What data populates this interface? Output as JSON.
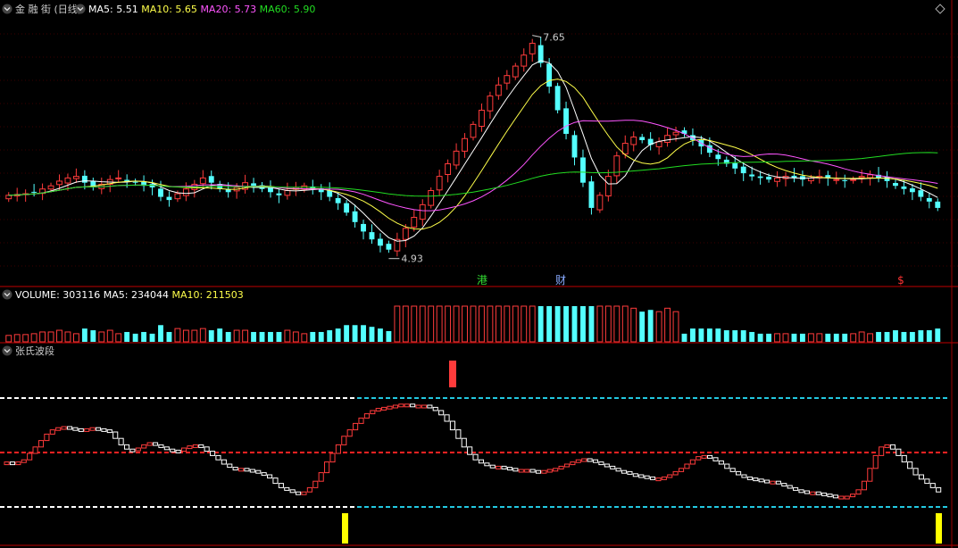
{
  "colors": {
    "up": "#ff3b3b",
    "down": "#54ffff",
    "ma5": "#ffffff",
    "ma10": "#ffff4a",
    "ma20": "#ff55ff",
    "ma60": "#22dd22",
    "sep": "#9a0000",
    "grid": "#7a0000",
    "label": "#cccccc",
    "cyan_line": "#22c8e0",
    "red_line": "#ff2222",
    "white_line": "#ffffff",
    "yellow": "#ffff00"
  },
  "price_panel": {
    "title": "金 融 街 (日线)",
    "indicators": [
      {
        "label": "MA5:",
        "value": "5.51",
        "color_key": "ma5"
      },
      {
        "label": "MA10:",
        "value": "5.65",
        "color_key": "ma10"
      },
      {
        "label": "MA20:",
        "value": "5.73",
        "color_key": "ma20"
      },
      {
        "label": "MA60:",
        "value": "5.90",
        "color_key": "ma60"
      }
    ],
    "high_label": "7.65",
    "low_label": "4.93",
    "markers": [
      {
        "text": "港",
        "color": "#33dd33"
      },
      {
        "text": "财",
        "color": "#88aaff"
      },
      {
        "text": "$",
        "color": "#ff3333"
      }
    ]
  },
  "volume_panel": {
    "indicators": [
      {
        "label": "VOLUME:",
        "value": "303116",
        "color_key": "ma5"
      },
      {
        "label": "MA5:",
        "value": "234044",
        "color_key": "ma5"
      },
      {
        "label": "MA10:",
        "value": "211503",
        "color_key": "ma10"
      }
    ]
  },
  "wave_panel": {
    "title": "张氏波段"
  },
  "chart_data": {
    "type": "candlestick",
    "title": "金 融 街 (日线)",
    "price_extremes": {
      "high": 7.65,
      "low": 4.93
    },
    "ma_latest": {
      "MA5": 5.51,
      "MA10": 5.65,
      "MA20": 5.73,
      "MA60": 5.9
    },
    "volume_latest": {
      "VOLUME": 303116,
      "MA5": 234044,
      "MA10": 211503
    },
    "close_series": [
      5.62,
      5.63,
      5.64,
      5.66,
      5.7,
      5.74,
      5.8,
      5.84,
      5.86,
      5.78,
      5.72,
      5.76,
      5.82,
      5.84,
      5.8,
      5.78,
      5.74,
      5.72,
      5.6,
      5.56,
      5.64,
      5.7,
      5.76,
      5.84,
      5.78,
      5.7,
      5.66,
      5.72,
      5.78,
      5.74,
      5.7,
      5.66,
      5.62,
      5.68,
      5.72,
      5.74,
      5.7,
      5.66,
      5.6,
      5.52,
      5.4,
      5.28,
      5.16,
      5.06,
      4.98,
      4.93,
      5.06,
      5.2,
      5.34,
      5.5,
      5.68,
      5.86,
      6.02,
      6.18,
      6.34,
      6.52,
      6.7,
      6.88,
      7.02,
      7.14,
      7.26,
      7.4,
      7.55,
      7.3,
      7.0,
      6.7,
      6.4,
      6.1,
      5.78,
      5.46,
      5.62,
      5.86,
      6.12,
      6.28,
      6.36,
      6.32,
      6.26,
      6.3,
      6.38,
      6.42,
      6.4,
      6.32,
      6.24,
      6.16,
      6.08,
      6.02,
      5.96,
      5.9,
      5.86,
      5.84,
      5.82,
      5.84,
      5.86,
      5.84,
      5.82,
      5.84,
      5.86,
      5.84,
      5.82,
      5.8,
      5.82,
      5.86,
      5.88,
      5.84,
      5.8,
      5.74,
      5.7,
      5.66,
      5.6,
      5.54,
      5.46
    ],
    "wave_series": [
      42,
      41,
      42,
      44,
      50,
      56,
      62,
      68,
      72,
      74,
      75,
      74,
      73,
      72,
      73,
      74,
      73,
      72,
      70,
      64,
      58,
      54,
      53,
      55,
      58,
      60,
      58,
      56,
      54,
      53,
      52,
      55,
      57,
      58,
      56,
      52,
      48,
      44,
      40,
      37,
      36,
      36,
      35,
      34,
      32,
      30,
      27,
      22,
      18,
      16,
      14,
      12,
      14,
      18,
      24,
      32,
      42,
      50,
      58,
      66,
      72,
      78,
      83,
      87,
      90,
      92,
      93,
      94,
      95,
      96,
      96,
      95,
      95,
      95,
      93,
      90,
      86,
      80,
      72,
      64,
      56,
      49,
      44,
      41,
      39,
      38,
      38,
      37,
      36,
      35,
      35,
      35,
      34,
      33,
      34,
      35,
      36,
      38,
      40,
      42,
      44,
      45,
      44,
      42,
      40,
      38,
      36,
      34,
      33,
      31,
      30,
      29,
      28,
      27,
      27,
      28,
      30,
      33,
      36,
      40,
      44,
      47,
      48,
      46,
      43,
      40,
      36,
      33,
      30,
      28,
      27,
      26,
      25,
      24,
      24,
      22,
      20,
      18,
      16,
      15,
      14,
      14,
      13,
      12,
      11,
      10,
      10,
      10,
      12,
      16,
      24,
      36,
      48,
      56,
      58,
      54,
      48,
      42,
      36,
      30,
      26,
      22,
      18,
      14
    ]
  }
}
